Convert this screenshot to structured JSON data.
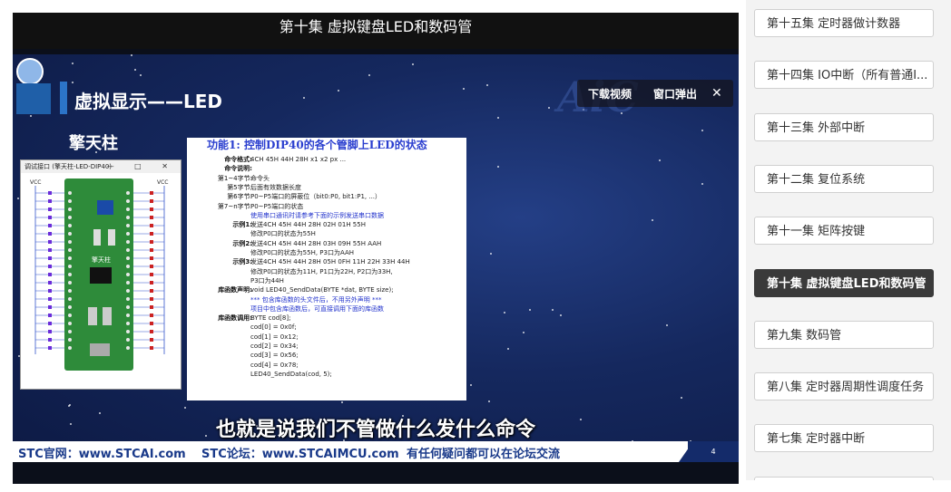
{
  "player": {
    "title": "第十集 虚拟键盘LED和数码管",
    "slide": {
      "heading": "虚拟显示——LED",
      "presenter": "擎天柱",
      "board_window_title": "调试接口 (擎天柱-LED-DIP40)",
      "board_controls": "—  □  ✕",
      "board_label": "擎天柱",
      "vcc_left": "VCC",
      "vcc_right": "VCC",
      "watermark": "AiC",
      "info": {
        "title": "功能1:  控制DIP40的各个管脚上LED的状态",
        "rows": [
          {
            "label": "命令格式:",
            "value": "4CH 45H 44H 28H x1 x2 px ..."
          },
          {
            "label": "命令说明:",
            "value": ""
          },
          {
            "label": "第1~4字节:",
            "value": "命令头"
          },
          {
            "label": "第5字节:",
            "value": "后面有效数据长度"
          },
          {
            "label": "第6字节:",
            "value": "P0~P5端口的屏蔽位（bit0:P0, bit1:P1, ...）"
          },
          {
            "label": "第7~n字节:",
            "value": "P0~P5端口的状态"
          },
          {
            "label": "",
            "value": "使用串口通讯时请参考下面的示例发送串口数据"
          },
          {
            "label": "示例1:",
            "value": "发送4CH 45H 44H 28H 02H 01H 55H"
          },
          {
            "label": "",
            "value": "修改P0口的状态为55H"
          },
          {
            "label": "示例2:",
            "value": "发送4CH 45H 44H 28H 03H 09H 55H AAH"
          },
          {
            "label": "",
            "value": "修改P0口的状态为55H, P3口为AAH"
          },
          {
            "label": "示例3:",
            "value": "发送4CH 45H 44H 28H 05H 0FH 11H 22H 33H 44H"
          },
          {
            "label": "",
            "value": "修改P0口的状态为11H, P1口为22H, P2口为33H,"
          },
          {
            "label": "",
            "value": "P3口为44H"
          },
          {
            "label": "库函数声明:",
            "value": "void LED40_SendData(BYTE *dat, BYTE size);"
          },
          {
            "label": "",
            "value": "*** 包含库函数的头文件后，不用另外声明 ***"
          },
          {
            "label": "",
            "value": "项目中包含库函数后，可直接调用下面的库函数"
          },
          {
            "label": "库函数调用:",
            "value": "BYTE cod[8];"
          },
          {
            "label": "",
            "value": "cod[0] = 0x0f;"
          },
          {
            "label": "",
            "value": "cod[1] = 0x12;"
          },
          {
            "label": "",
            "value": "cod[2] = 0x34;"
          },
          {
            "label": "",
            "value": "cod[3] = 0x56;"
          },
          {
            "label": "",
            "value": "cod[4] = 0x78;"
          },
          {
            "label": "",
            "value": "LED40_SendData(cod, 5);"
          }
        ]
      },
      "subtitle": "也就是说我们不管做什么发什么命令",
      "footer": {
        "site": "STC官网：www.STCAI.com",
        "forum": "STC论坛：www.STCAIMCU.com",
        "note": "有任何疑问都可以在论坛交流",
        "page": "4"
      }
    },
    "overlay": {
      "download_label": "下载视频",
      "popout_label": "窗口弹出",
      "close_symbol": "✕"
    }
  },
  "playlist": {
    "items": [
      {
        "label": "第十五集 定时器做计数器",
        "active": false
      },
      {
        "label": "第十四集 IO中断（所有普通I...",
        "active": false
      },
      {
        "label": "第十三集 外部中断",
        "active": false
      },
      {
        "label": "第十二集 复位系统",
        "active": false
      },
      {
        "label": "第十一集 矩阵按键",
        "active": false
      },
      {
        "label": "第十集 虚拟键盘LED和数码管",
        "active": true
      },
      {
        "label": "第九集 数码管",
        "active": false
      },
      {
        "label": "第八集 定时器周期性调度任务",
        "active": false
      },
      {
        "label": "第七集 定时器中断",
        "active": false
      },
      {
        "label": "",
        "active": false
      }
    ]
  }
}
